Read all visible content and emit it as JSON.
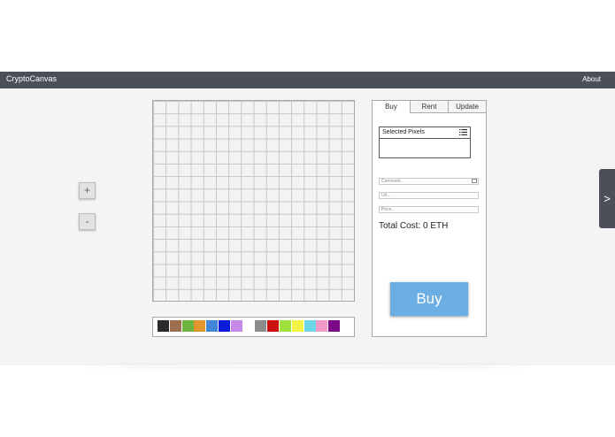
{
  "navbar": {
    "brand": "CryptoCanvas",
    "about": "About"
  },
  "zoom": {
    "in_label": "+",
    "out_label": "-"
  },
  "palette": {
    "colors": [
      "#2b2b2b",
      "#9c6f4e",
      "#6db33f",
      "#e0962c",
      "#3f86d8",
      "#0b1bd9",
      "#c58ae8",
      "#ffffff",
      "#8c8c8c",
      "#cc1010",
      "#9fe03d",
      "#f2f247",
      "#6cd6e6",
      "#f29ac7",
      "#7a0a88",
      "#ffffff"
    ]
  },
  "panel": {
    "tabs": [
      "Buy",
      "Rent",
      "Update"
    ],
    "active_tab": "Buy",
    "selected_pixels_label": "Selected Pixels",
    "comment_placeholder": "Comment...",
    "url_placeholder": "Url...",
    "price_placeholder": "Price...",
    "total_cost": "Total Cost: 0 ETH",
    "buy_label": "Buy"
  },
  "side_toggle": {
    "label": ">"
  },
  "colors": {
    "navbar": "#4b4f57",
    "buy_button": "#6baee3",
    "background": "#f4f4f4"
  }
}
